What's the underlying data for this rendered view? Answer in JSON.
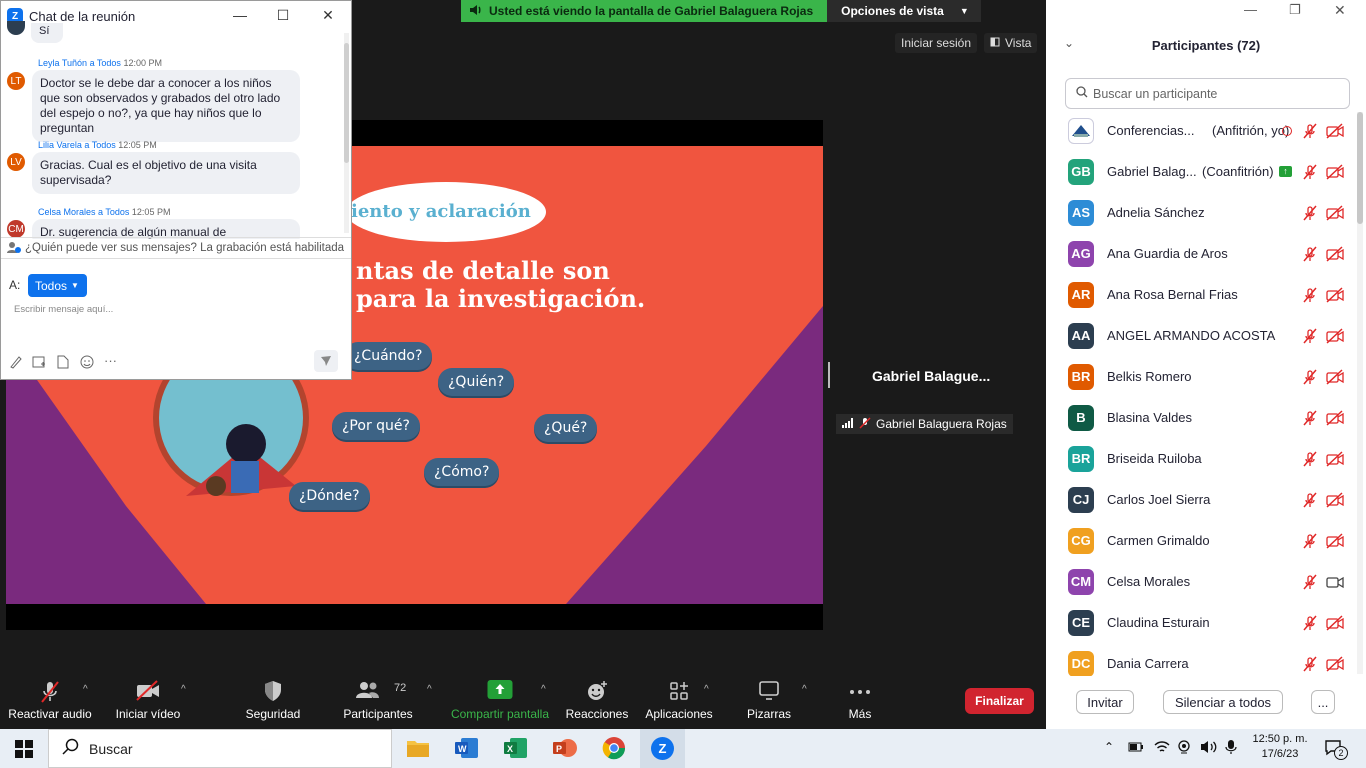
{
  "share_banner": {
    "text": "Usted está viendo la pantalla de Gabriel Balaguera Rojas",
    "options_label": "Opciones de vista"
  },
  "top_controls": {
    "signin": "Iniciar sesión",
    "view": "Vista"
  },
  "speaker": {
    "name_large": "Gabriel  Balague...",
    "name_tag": "Gabriel Balaguera Rojas"
  },
  "slide": {
    "banner_text": "iento y aclaración",
    "line1": "ntas de detalle son",
    "line2": "para la investigación.",
    "bubbles": [
      "¿Cuándo?",
      "¿Quién?",
      "¿Por qué?",
      "¿Qué?",
      "¿Cómo?",
      "¿Dónde?"
    ]
  },
  "chat": {
    "title": "Chat de la reunión",
    "first_msg": "Sí",
    "messages": [
      {
        "initials": "LT",
        "sender": "Leyla Tuñón",
        "to": "a Todos",
        "time": "12:00 PM",
        "text": "Doctor se le debe dar a conocer a los niños que son observados y grabados del otro lado del espejo o no?, ya que hay niños que lo preguntan"
      },
      {
        "initials": "LV",
        "sender": "Lilia Varela",
        "to": "a Todos",
        "time": "12:05 PM",
        "text": "Gracias. Cual es el objetivo de una visita supervisada?"
      },
      {
        "initials": "CM",
        "sender": "Celsa Morales",
        "to": "a Todos",
        "time": "12:05 PM",
        "text": "Dr. sugerencia de algún manual de"
      }
    ],
    "recording_notice": "¿Quién puede ver sus mensajes? La grabación está habilitada",
    "to_label": "A:",
    "to_value": "Todos",
    "input_placeholder": "Escribir mensaje aquí..."
  },
  "participants": {
    "title": "Participantes (72)",
    "search_placeholder": "Buscar un participante",
    "list": [
      {
        "initials": "",
        "name": "Conferencias...",
        "role": "(Anfitrión, yo)",
        "color": "#ffffff"
      },
      {
        "initials": "GB",
        "name": "Gabriel Balag...",
        "role": "(Coanfitrión)",
        "color": "#23a37b"
      },
      {
        "initials": "AS",
        "name": "Adnelia Sánchez",
        "role": "",
        "color": "#2d8cd6"
      },
      {
        "initials": "AG",
        "name": "Ana Guardia de Aros",
        "role": "",
        "color": "#8e44ad"
      },
      {
        "initials": "AR",
        "name": "Ana Rosa Bernal Frias",
        "role": "",
        "color": "#e05a00"
      },
      {
        "initials": "AA",
        "name": "ANGEL ARMANDO ACOSTA",
        "role": "",
        "color": "#2c3e50"
      },
      {
        "initials": "BR",
        "name": "Belkis Romero",
        "role": "",
        "color": "#e05a00"
      },
      {
        "initials": "B",
        "name": "Blasina Valdes",
        "role": "",
        "color": "#0f5a45"
      },
      {
        "initials": "BR",
        "name": "Briseida Ruiloba",
        "role": "",
        "color": "#1aa39a"
      },
      {
        "initials": "CJ",
        "name": "Carlos Joel Sierra",
        "role": "",
        "color": "#2c3e50"
      },
      {
        "initials": "CG",
        "name": "Carmen Grimaldo",
        "role": "",
        "color": "#f0a020"
      },
      {
        "initials": "CM",
        "name": "Celsa Morales",
        "role": "",
        "color": "#8e44ad"
      },
      {
        "initials": "CE",
        "name": "Claudina Esturain",
        "role": "",
        "color": "#2c3e50"
      },
      {
        "initials": "DC",
        "name": "Dania Carrera",
        "role": "",
        "color": "#f0a020"
      }
    ],
    "invite": "Invitar",
    "mute_all": "Silenciar a todos",
    "more": "..."
  },
  "toolbar": {
    "unmute": "Reactivar audio",
    "start_video": "Iniciar vídeo",
    "security": "Seguridad",
    "participants": "Participantes",
    "participants_count": "72",
    "share": "Compartir pantalla",
    "reactions": "Reacciones",
    "apps": "Aplicaciones",
    "whiteboards": "Pizarras",
    "more": "Más",
    "end": "Finalizar"
  },
  "taskbar": {
    "search": "Buscar",
    "time": "12:50 p. m.",
    "date": "17/6/23",
    "notifications": "2"
  },
  "colors": {
    "zoom_blue": "#0e72ed",
    "share_green": "#3ab54a",
    "end_red": "#d1242f",
    "slide_orange": "#f0553f",
    "slide_purple": "#7a2a7e"
  }
}
